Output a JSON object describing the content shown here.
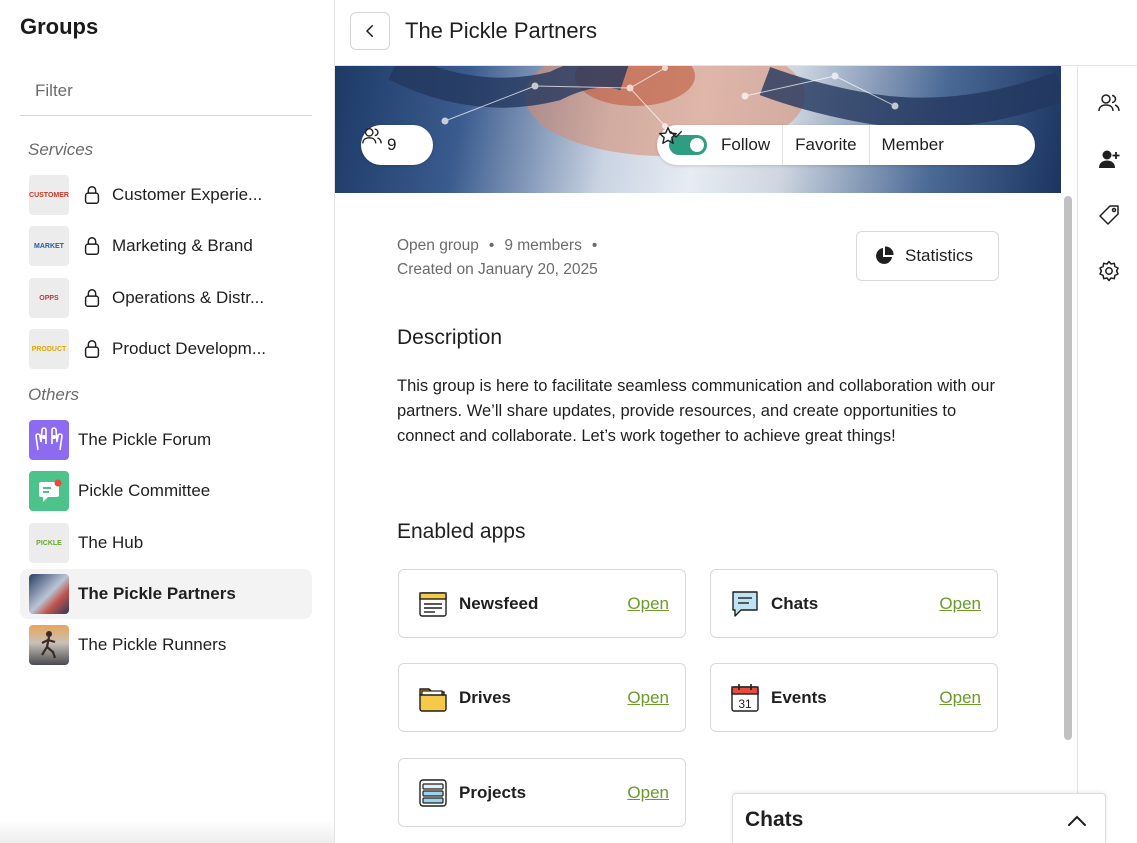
{
  "sidebar": {
    "title": "Groups",
    "filter_placeholder": "Filter",
    "sections": {
      "services_label": "Services",
      "others_label": "Others"
    },
    "services": [
      {
        "label": "Customer Experie...",
        "thumb_text": "CUSTOMER",
        "thumb_color": "#c0392b"
      },
      {
        "label": "Marketing & Brand",
        "thumb_text": "MARKET",
        "thumb_color": "#1f5fa8"
      },
      {
        "label": "Operations & Distr...",
        "thumb_text": "OPPS",
        "thumb_color": "#b03a48"
      },
      {
        "label": "Product Developm...",
        "thumb_text": "PRODUCT",
        "thumb_color": "#e0a800"
      }
    ],
    "others": [
      {
        "label": "The Pickle Forum"
      },
      {
        "label": "Pickle Committee"
      },
      {
        "label": "The Hub",
        "thumb_text": "PICKLE",
        "thumb_color": "#6aa532"
      },
      {
        "label": "The Pickle Partners",
        "active": true
      },
      {
        "label": "The Pickle Runners"
      }
    ]
  },
  "header": {
    "title": "The Pickle Partners"
  },
  "banner": {
    "member_count": "9",
    "follow_label": "Follow",
    "follow_on": true,
    "favorite_label": "Favorite",
    "member_label": "Member"
  },
  "meta": {
    "group_type": "Open group",
    "members": "9 members",
    "created": "Created on January 20, 2025"
  },
  "statistics_label": "Statistics",
  "description": {
    "heading": "Description",
    "text": "This group is here to facilitate seamless communication and collaboration with our partners. We’ll share updates, provide resources, and create opportunities to connect and collaborate. Let’s work together to achieve great things!"
  },
  "apps": {
    "heading": "Enabled apps",
    "open_label": "Open",
    "items": [
      {
        "name": "Newsfeed",
        "icon": "newsfeed-icon"
      },
      {
        "name": "Chats",
        "icon": "chat-bubble-icon"
      },
      {
        "name": "Drives",
        "icon": "folder-icon"
      },
      {
        "name": "Events",
        "icon": "calendar-icon",
        "calendar_day": "31"
      },
      {
        "name": "Projects",
        "icon": "projects-icon"
      }
    ]
  },
  "chats_dock": {
    "label": "Chats"
  },
  "colors": {
    "accent_green": "#2e9e83",
    "link_green": "#6a9a2a",
    "text": "#1f1f1f",
    "muted": "#6b6b6b"
  }
}
